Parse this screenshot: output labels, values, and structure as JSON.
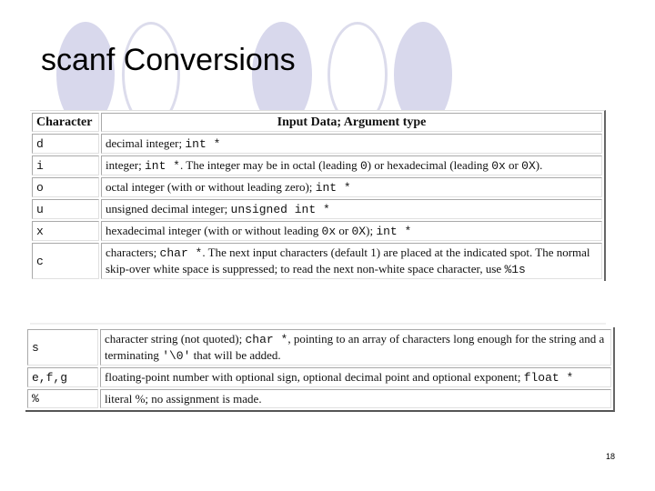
{
  "slide": {
    "title": "scanf Conversions",
    "page_number": "18",
    "decor": {
      "circle_fill_color": "#d8d8ec",
      "circle_outline_color": "#dcdcec",
      "circles": [
        "filled",
        "outline",
        "filled",
        "outline",
        "filled"
      ]
    }
  },
  "table": {
    "headers": [
      "Character",
      "Input Data; Argument type"
    ],
    "rows": [
      {
        "char": "d",
        "desc": [
          {
            "t": "decimal integer; "
          },
          {
            "m": "int *"
          }
        ]
      },
      {
        "char": "i",
        "desc": [
          {
            "t": "integer; "
          },
          {
            "m": "int *"
          },
          {
            "t": ". The integer may be in octal (leading "
          },
          {
            "m": "0"
          },
          {
            "t": ") or hexadecimal (leading "
          },
          {
            "m": "0x"
          },
          {
            "t": " or "
          },
          {
            "m": "0X"
          },
          {
            "t": ")."
          }
        ]
      },
      {
        "char": "o",
        "desc": [
          {
            "t": "octal integer (with or without leading zero); "
          },
          {
            "m": "int *"
          }
        ]
      },
      {
        "char": "u",
        "desc": [
          {
            "t": "unsigned decimal integer; "
          },
          {
            "m": "unsigned int *"
          }
        ]
      },
      {
        "char": "x",
        "desc": [
          {
            "t": "hexadecimal integer (with or without leading "
          },
          {
            "m": "0x"
          },
          {
            "t": " or "
          },
          {
            "m": "0X"
          },
          {
            "t": "); "
          },
          {
            "m": "int *"
          }
        ]
      },
      {
        "char": "c",
        "desc": [
          {
            "t": "characters; "
          },
          {
            "m": "char *"
          },
          {
            "t": ". The next input characters (default 1) are placed at the indicated spot. The normal skip-over white space is suppressed; to read the next non-white space character, use "
          },
          {
            "m": "%1s"
          }
        ]
      }
    ],
    "rows_continued": [
      {
        "char": "s",
        "desc": [
          {
            "t": "character string (not quoted); "
          },
          {
            "m": "char *"
          },
          {
            "t": ", pointing to an array of characters long enough for the string and a terminating "
          },
          {
            "m": "'\\0'"
          },
          {
            "t": " that will be added."
          }
        ]
      },
      {
        "char": "e,f,g",
        "desc": [
          {
            "t": "floating-point number with optional sign, optional decimal point and optional exponent; "
          },
          {
            "m": "float *"
          }
        ]
      },
      {
        "char": "%",
        "desc": [
          {
            "t": "literal %; no assignment is made."
          }
        ]
      }
    ]
  }
}
